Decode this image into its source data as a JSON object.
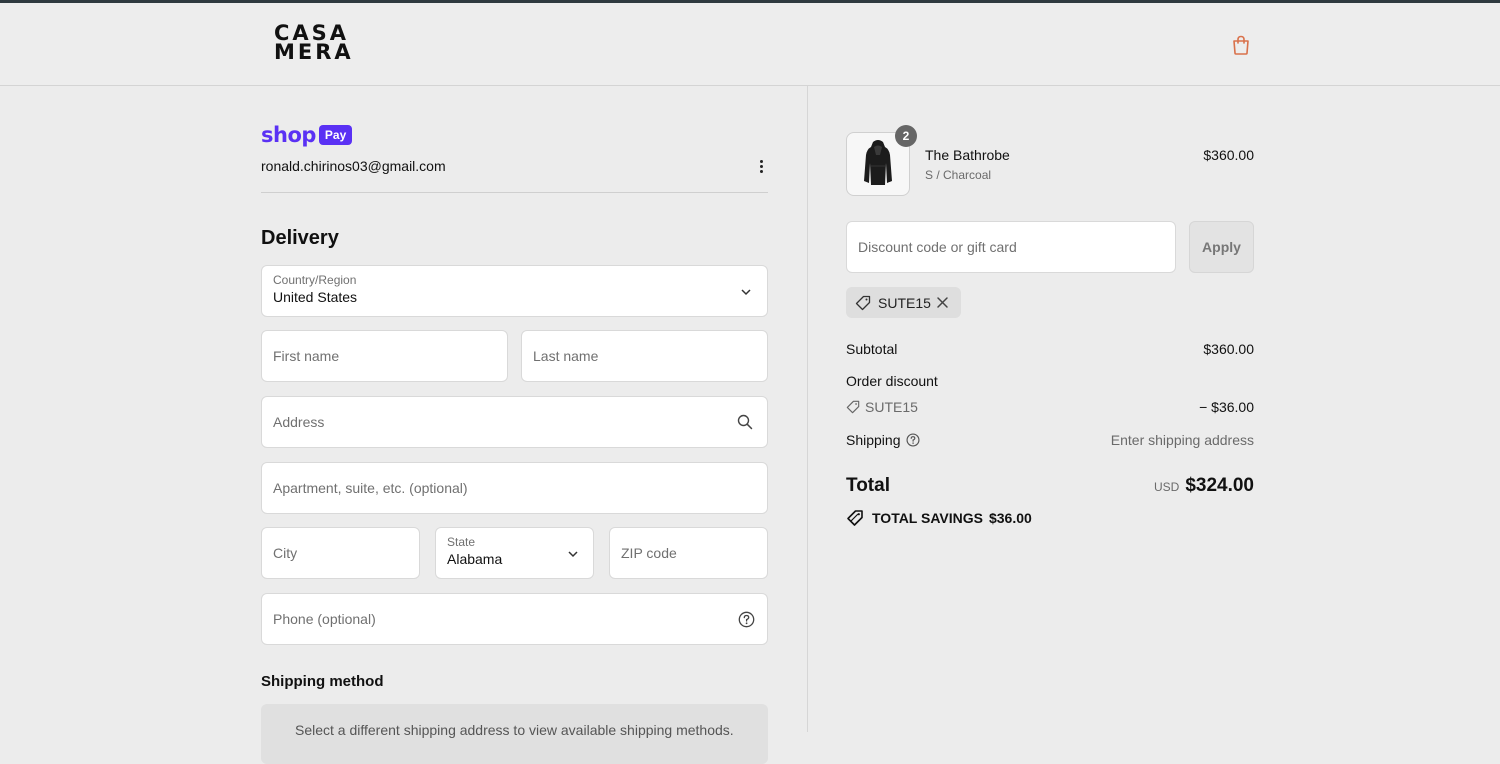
{
  "header": {
    "logo_line1": "CASA",
    "logo_line2": "MERA",
    "cart_icon": "shopping-bag-icon",
    "accent_color": "#d9714b"
  },
  "account": {
    "shop_label": "shop",
    "pay_label": "Pay",
    "email": "ronald.chirinos03@gmail.com",
    "brand_color": "#5a31f4"
  },
  "delivery": {
    "heading": "Delivery",
    "country_label": "Country/Region",
    "country_value": "United States",
    "first_name_placeholder": "First name",
    "last_name_placeholder": "Last name",
    "address_placeholder": "Address",
    "apartment_placeholder": "Apartment, suite, etc. (optional)",
    "city_placeholder": "City",
    "state_label": "State",
    "state_value": "Alabama",
    "zip_placeholder": "ZIP code",
    "phone_placeholder": "Phone (optional)"
  },
  "shipping_method": {
    "heading": "Shipping method",
    "notice": "Select a different shipping address to view available shipping methods."
  },
  "cart": {
    "item": {
      "quantity": "2",
      "name": "The Bathrobe",
      "variant": "S / Charcoal",
      "price": "$360.00"
    },
    "discount_placeholder": "Discount code or gift card",
    "apply_label": "Apply",
    "applied_code": "SUTE15"
  },
  "summary": {
    "subtotal_label": "Subtotal",
    "subtotal_value": "$360.00",
    "order_discount_label": "Order discount",
    "discount_code": "SUTE15",
    "discount_value": "− $36.00",
    "shipping_label": "Shipping",
    "shipping_value": "Enter shipping address",
    "total_label": "Total",
    "total_currency": "USD",
    "total_value": "$324.00",
    "savings_label": "TOTAL SAVINGS",
    "savings_value": "$36.00"
  }
}
